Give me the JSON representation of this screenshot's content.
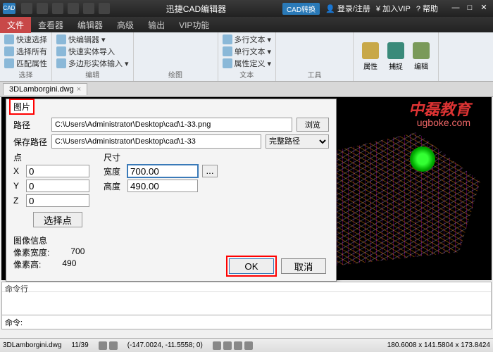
{
  "titlebar": {
    "app_badge": "CAD",
    "title": "迅捷CAD编辑器",
    "convert": "CAD转换",
    "login": "登录/注册",
    "vip": "加入VIP",
    "help": "帮助"
  },
  "menu": {
    "file": "文件",
    "viewer": "查看器",
    "editor": "编辑器",
    "advanced": "高级",
    "output": "输出",
    "vipfn": "VIP功能"
  },
  "ribbon": {
    "g1": {
      "i1": "快速选择",
      "i2": "选择所有",
      "i3": "匹配属性",
      "label": "选择"
    },
    "g2": {
      "i1": "快编辑器",
      "i2": "快速实体导入",
      "i3": "多边形实体输入",
      "label": "编辑"
    },
    "drawlabel": "绘图",
    "g3": {
      "i1": "多行文本",
      "i2": "单行文本",
      "i3": "属性定义",
      "label": "文本"
    },
    "toolslabel": "工具",
    "btn_attr": "属性",
    "btn_cap": "捕捉",
    "btn_edit": "编辑"
  },
  "doc": {
    "name": "3DLamborgini.dwg"
  },
  "watermark": {
    "l1": "中磊教育",
    "l2": "ugboke.com"
  },
  "dialog": {
    "tab": "图片",
    "path_label": "路径",
    "path_val": "C:\\Users\\Administrator\\Desktop\\cad\\1-33.png",
    "browse": "浏览",
    "save_label": "保存路径",
    "save_val": "C:\\Users\\Administrator\\Desktop\\cad\\1-33",
    "save_mode": "完整路径",
    "pt_title": "点",
    "X": "0",
    "Y": "0",
    "Z": "0",
    "selpt": "选择点",
    "sz_title": "尺寸",
    "w_label": "宽度",
    "w_val": "700.00",
    "h_label": "高度",
    "h_val": "490.00",
    "dots": "...",
    "info_title": "图像信息",
    "pxw_label": "像素宽度:",
    "pxw": "700",
    "pxh_label": "像素高:",
    "pxh": "490",
    "ok": "OK",
    "cancel": "取消"
  },
  "cmd": {
    "hist": "命令行",
    "prompt": "命令:"
  },
  "status": {
    "doc": "3DLamborgini.dwg",
    "prog": "11/39",
    "coord1": "(-147.0024, -11.5558; 0)",
    "coords": "180.6008 x 141.5804 x 173.8424"
  }
}
